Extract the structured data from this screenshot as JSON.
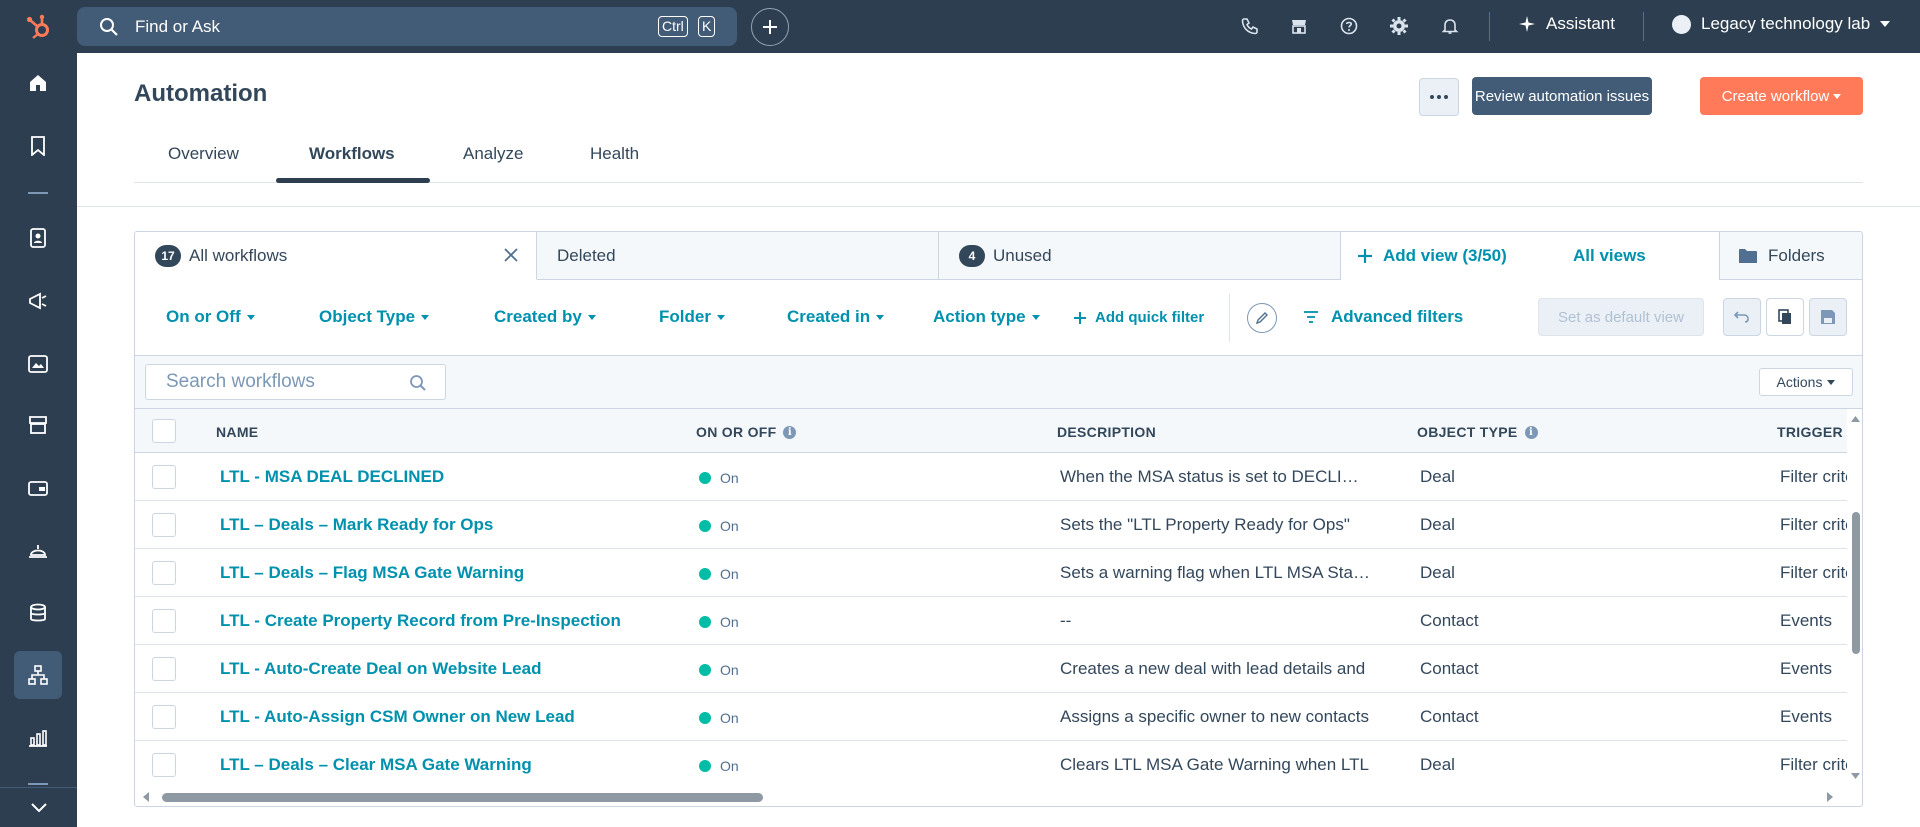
{
  "topnav": {
    "search_placeholder": "Find or Ask",
    "kbd_ctrl": "Ctrl",
    "kbd_k": "K",
    "assistant_label": "Assistant",
    "account_name": "Legacy technology lab"
  },
  "header": {
    "title": "Automation",
    "review_button": "Review automation issues",
    "create_button": "Create workflow"
  },
  "tabs": [
    "Overview",
    "Workflows",
    "Analyze",
    "Health"
  ],
  "views": {
    "all": {
      "count": "17",
      "label": "All workflows"
    },
    "deleted": {
      "label": "Deleted"
    },
    "unused": {
      "count": "4",
      "label": "Unused"
    },
    "add_view": "Add view (3/50)",
    "all_views": "All views",
    "folders": "Folders"
  },
  "filters": {
    "items": [
      "On or Off",
      "Object Type",
      "Created by",
      "Folder",
      "Created in",
      "Action type"
    ],
    "add_quick_filter": "Add quick filter",
    "advanced": "Advanced filters",
    "set_default": "Set as default view"
  },
  "toolbar": {
    "search_placeholder": "Search workflows",
    "actions": "Actions"
  },
  "table": {
    "columns": [
      "NAME",
      "ON OR OFF",
      "DESCRIPTION",
      "OBJECT TYPE",
      "TRIGGER"
    ],
    "rows": [
      {
        "name": "LTL - MSA DEAL DECLINED",
        "status": "On",
        "description": "When the MSA status is set to DECLINED",
        "object_type": "Deal",
        "trigger": "Filter criteria"
      },
      {
        "name": "LTL – Deals – Mark Ready for Ops",
        "status": "On",
        "description": "Sets the \"LTL Property Ready for Ops\"",
        "object_type": "Deal",
        "trigger": "Filter criteria"
      },
      {
        "name": "LTL – Deals – Flag MSA Gate Warning",
        "status": "On",
        "description": "Sets a warning flag when LTL MSA Status",
        "object_type": "Deal",
        "trigger": "Filter criteria"
      },
      {
        "name": "LTL - Create Property Record from Pre-Inspection",
        "status": "On",
        "description": "--",
        "object_type": "Contact",
        "trigger": "Events"
      },
      {
        "name": "LTL - Auto-Create Deal on Website Lead",
        "status": "On",
        "description": "Creates a new deal with lead details and",
        "object_type": "Contact",
        "trigger": "Events"
      },
      {
        "name": "LTL - Auto-Assign CSM Owner on New Lead",
        "status": "On",
        "description": "Assigns a specific owner to new contacts",
        "object_type": "Contact",
        "trigger": "Events"
      },
      {
        "name": "LTL – Deals – Clear MSA Gate Warning",
        "status": "On",
        "description": "Clears LTL MSA Gate Warning when LTL",
        "object_type": "Deal",
        "trigger": "Filter criteria"
      }
    ]
  },
  "colors": {
    "nav_bg": "#2d3e50",
    "link": "#0091ae",
    "primary_orange": "#ff7a59",
    "secondary_dark": "#425b76",
    "status_on": "#00bda5"
  },
  "icons": {
    "logo": "hubspot-sprocket-icon",
    "sidebar": [
      "home-icon",
      "bookmark-icon",
      "contacts-icon",
      "marketing-icon",
      "content-icon",
      "commerce-icon",
      "payments-icon",
      "service-icon",
      "data-icon",
      "automation-icon",
      "reporting-icon"
    ]
  }
}
